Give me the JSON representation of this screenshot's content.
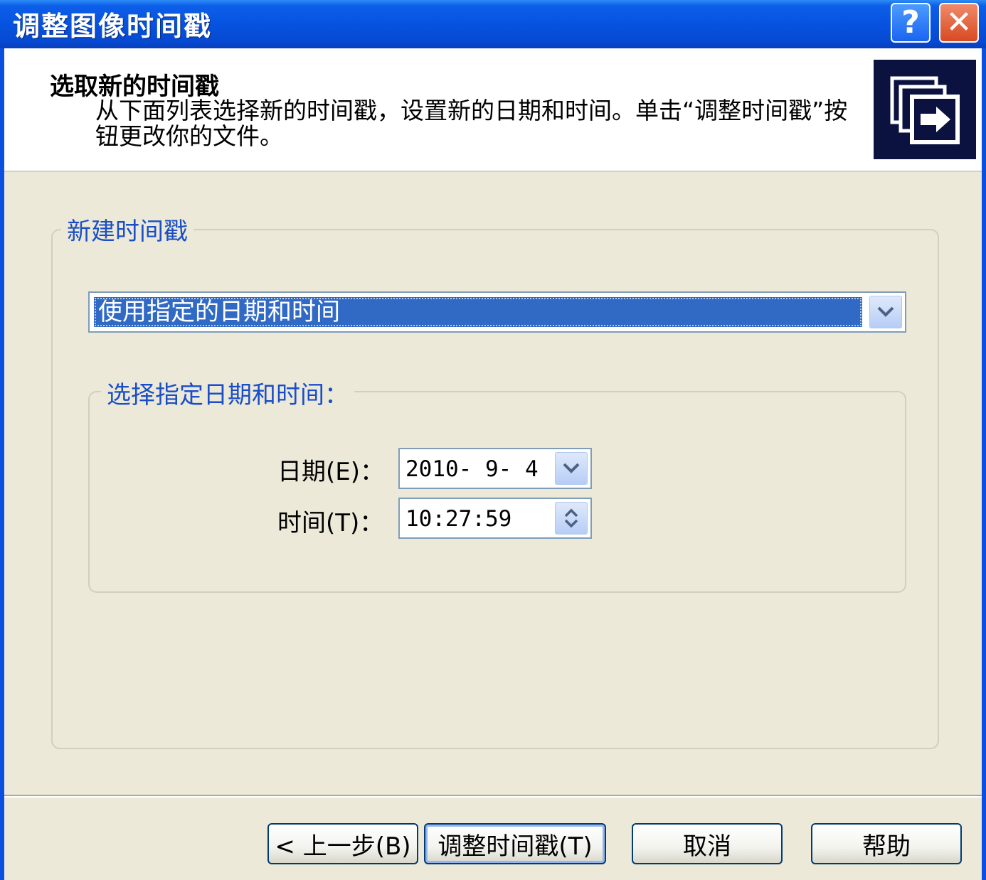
{
  "window": {
    "title": "调整图像时间戳",
    "help_label": "?",
    "close_label": "✕"
  },
  "header": {
    "title": "选取新的时间戳",
    "description": "从下面列表选择新的时间戳，设置新的日期和时间。单击“调整时间戳”按钮更改你的文件。",
    "icon": "copy-arrow-icon"
  },
  "timestamp_group": {
    "legend": "新建时间戳",
    "mode_select": {
      "selected": "使用指定的日期和时间"
    }
  },
  "datetime_group": {
    "legend": "选择指定日期和时间：",
    "date_label": "日期(E)：",
    "date_value": "2010- 9- 4",
    "time_label": "时间(T)：",
    "time_value": "10:27:59"
  },
  "buttons": {
    "back": "< 上一步(B)",
    "adjust": "调整时间戳(T)",
    "cancel": "取消",
    "help": "帮助"
  },
  "colors": {
    "titlebar": "#0653e0",
    "selection": "#316ac5",
    "legend_text": "#1a4ec8",
    "dialog_bg": "#ece9d8"
  }
}
